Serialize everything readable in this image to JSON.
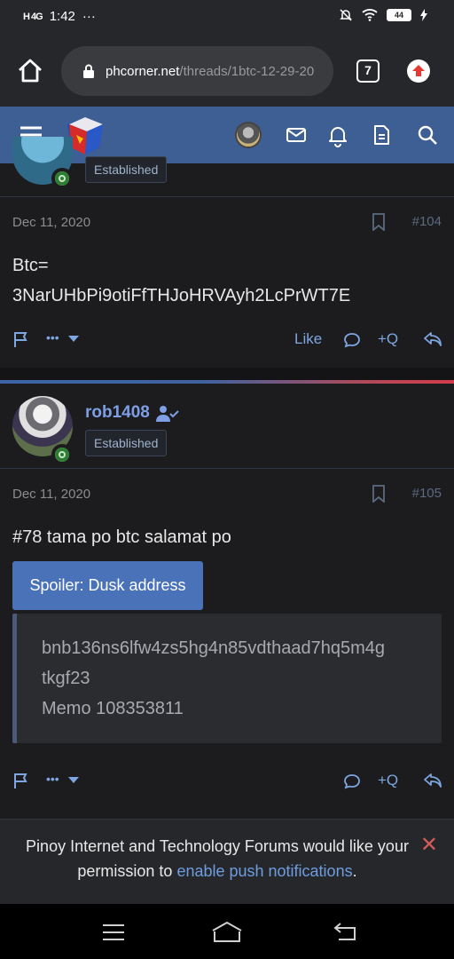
{
  "status_bar": {
    "signal": "H 4G",
    "time": "1:42",
    "dots": "···",
    "battery": "44"
  },
  "browser": {
    "url_domain": "phcorner.net",
    "url_path": "/threads/1btc-12-29-20",
    "tab_count": "7"
  },
  "previous_post": {
    "user_badge": "Established",
    "date": "Dec 11, 2020",
    "number": "#104",
    "body_line1": "Btc=",
    "body_line2": "3NarUHbPi9otiFfTHJoHRVAyh2LcPrWT7E",
    "more_label": "•••",
    "like_label": "Like",
    "quote_label": "+Q"
  },
  "post": {
    "username": "rob1408",
    "user_badge": "Established",
    "date": "Dec 11, 2020",
    "number": "#105",
    "body": "#78 tama po btc salamat po",
    "spoiler_label": "Spoiler: Dusk address",
    "spoiler_line1": "bnb136ns6lfw4zs5hg4n85vdthaad7hq5m4g",
    "spoiler_line2": "tkgf23",
    "spoiler_line3": "Memo 108353811",
    "more_label": "•••",
    "quote_label": "+Q"
  },
  "notification_banner": {
    "text_before": "Pinoy Internet and Technology Forums would like your permission to ",
    "link_text": "enable push notifications",
    "text_after": ".",
    "close_label": "✕"
  },
  "colors": {
    "header_bg": "#3e5f94",
    "accent_link": "#7ea6e0",
    "spoiler_button": "#4a72b8",
    "online_dot": "#2f7d32",
    "close_red": "#d45a5a"
  }
}
